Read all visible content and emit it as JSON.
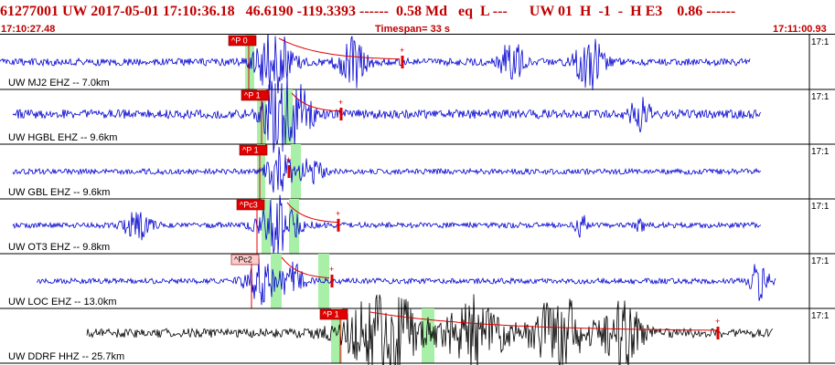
{
  "header": {
    "title_line": "61277001 UW 2017-05-01 17:10:36.18   46.6190 -119.3393 ------  0.58 Md   eq  L ---      UW 01  H  -1  -  H E3    0.86 ------",
    "start_time": "17:10:27.48",
    "timespan": "Timespan= 33 s",
    "end_time": "17:11:00.93"
  },
  "colors": {
    "header_text": "#c00000",
    "trace_blue": "#0000d0",
    "trace_black": "#000000",
    "pick_green": "#a8f0a8",
    "phase_red": "#e00000",
    "phase_pink": "#ffcccc"
  },
  "channels": [
    {
      "label": "UW MJ2 EHZ -- 7.0km",
      "phase": "P 0",
      "phase_style": "red",
      "right_time": "17:1",
      "color": "blue"
    },
    {
      "label": "UW HGBL EHZ -- 9.6km",
      "phase": "P 1",
      "phase_style": "red",
      "right_time": "17:1",
      "color": "blue"
    },
    {
      "label": "UW GBL EHZ -- 9.6km",
      "phase": "P 1",
      "phase_style": "red",
      "right_time": "17:1",
      "color": "blue"
    },
    {
      "label": "UW OT3 EHZ -- 9.8km",
      "phase": "Pc3",
      "phase_style": "red",
      "right_time": "17:1",
      "color": "blue"
    },
    {
      "label": "UW LOC EHZ -- 13.0km",
      "phase": "Pc2",
      "phase_style": "pink",
      "right_time": "17:1",
      "color": "blue"
    },
    {
      "label": "UW DDRF HHZ -- 25.7km",
      "phase": "P 1",
      "phase_style": "red",
      "right_time": "17:1",
      "color": "black"
    }
  ]
}
